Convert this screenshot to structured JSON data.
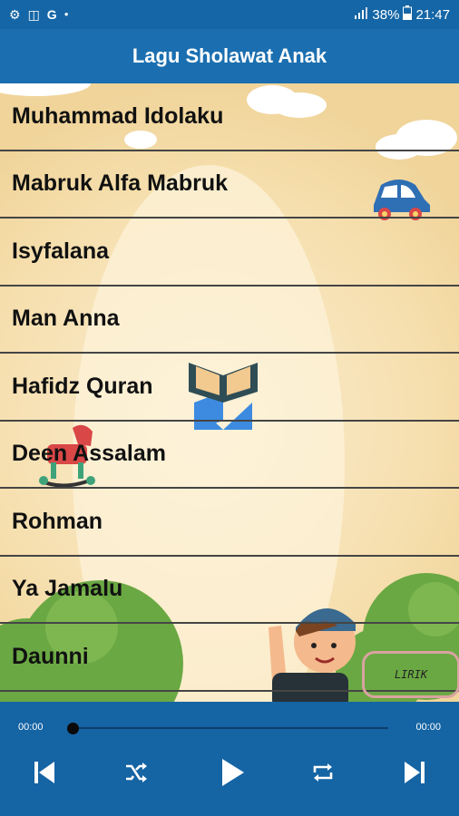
{
  "status_bar": {
    "left_icons": [
      "settings-icon",
      "app-icon",
      "google-icon",
      "dot-icon"
    ],
    "google_letter": "G",
    "battery": "38%",
    "time": "21:47"
  },
  "app_bar": {
    "title": "Lagu Sholawat Anak"
  },
  "songs": [
    "Muhammad Idolaku",
    "Mabruk Alfa Mabruk",
    "Isyfalana",
    "Man Anna",
    "Hafidz Quran",
    "Deen Assalam",
    "Rohman",
    "Ya Jamalu",
    "Daunni"
  ],
  "lirik_button": {
    "label": "LIRIK"
  },
  "player": {
    "time_elapsed": "00:00",
    "time_total": "00:00",
    "progress": 0,
    "controls": [
      "skip-previous-icon",
      "shuffle-icon",
      "play-icon",
      "repeat-icon",
      "skip-next-icon"
    ]
  },
  "colors": {
    "status_bar": "#1566a6",
    "app_bar": "#1b6fb0",
    "player": "#1564a4",
    "background": "#f6dfae"
  }
}
